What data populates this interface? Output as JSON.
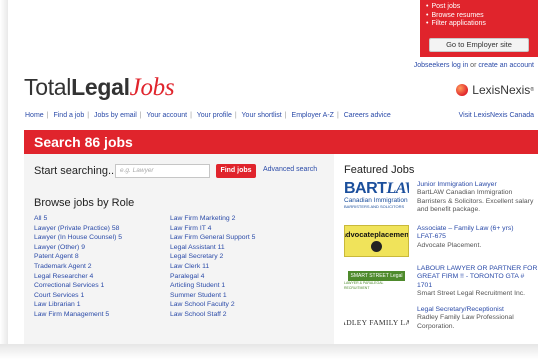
{
  "employer_box": {
    "items": [
      "Post jobs",
      "Browse resumes",
      "Filter applications"
    ],
    "button_label": "Go to Employer site"
  },
  "account_links": {
    "login": "Jobseekers log in",
    "or": "or",
    "create": "create an account"
  },
  "logo": {
    "part1": "Total",
    "part2": "Legal",
    "part3": "Jobs"
  },
  "partner_logo": {
    "label": "LexisNexis",
    "mark": "®"
  },
  "nav": {
    "items": [
      "Home",
      "Find a job",
      "Jobs by email",
      "Your account",
      "Your profile",
      "Your shortlist",
      "Employer A-Z",
      "Careers advice"
    ],
    "visit_link": "Visit LexisNexis Canada"
  },
  "search_banner": {
    "title": "Search 86 jobs"
  },
  "search": {
    "heading": "Start searching...",
    "placeholder": "e.g. Lawyer",
    "find_button": "Find jobs",
    "advanced_link": "Advanced search"
  },
  "browse": {
    "heading": "Browse jobs by Role",
    "col1": [
      {
        "label": "All",
        "count": "5"
      },
      {
        "label": "Lawyer (Private Practice)",
        "count": "58"
      },
      {
        "label": "Lawyer (In House Counsel)",
        "count": "5"
      },
      {
        "label": "Lawyer (Other)",
        "count": "9"
      },
      {
        "label": "Patent Agent",
        "count": "8"
      },
      {
        "label": "Trademark Agent",
        "count": "2"
      },
      {
        "label": "Legal Researcher",
        "count": "4"
      },
      {
        "label": "Correctional Services",
        "count": "1"
      },
      {
        "label": "Court Services",
        "count": "1"
      },
      {
        "label": "Law Librarian",
        "count": "1"
      },
      {
        "label": "Law Firm Management",
        "count": "5"
      }
    ],
    "col2": [
      {
        "label": "Law Firm Marketing",
        "count": "2"
      },
      {
        "label": "Law Firm IT",
        "count": "4"
      },
      {
        "label": "Law Firm General Support",
        "count": "5"
      },
      {
        "label": "Legal Assistant",
        "count": "11"
      },
      {
        "label": "Legal Secretary",
        "count": "2"
      },
      {
        "label": "Law Clerk",
        "count": "11"
      },
      {
        "label": "Paralegal",
        "count": "4"
      },
      {
        "label": "Articling Student",
        "count": "1"
      },
      {
        "label": "Summer Student",
        "count": "1"
      },
      {
        "label": "Law School Faculty",
        "count": "2"
      },
      {
        "label": "Law School Staff",
        "count": "2"
      }
    ]
  },
  "featured": {
    "heading": "Featured Jobs",
    "jobs": [
      {
        "title": "Junior Immigration Lawyer",
        "desc": "BartLAW Canadian Immigration Barristers & Solicitors. Excellent salary and benefit package.",
        "logo": {
          "line1": "BART",
          "line1b": "LAW",
          "line2": "Canadian Immigration",
          "line3": "BARRISTERS AND SOLICITORS"
        }
      },
      {
        "title": "Associate – Family Law (6+ yrs)",
        "title2": "LFAT-675",
        "desc": "Advocate Placement.",
        "logo": {
          "line1": "advocateplacement",
          "line2": "LAW"
        }
      },
      {
        "title": "LABOUR LAWYER OR PARTNER FOR GREAT FIRM !! - TORONTO GTA # 1701",
        "desc": "Smart Street Legal Recruitment Inc.",
        "logo": {
          "line1": "SMART STREET Legal",
          "line2": "LAWYER & PARALEGAL RECRUITMENT"
        }
      },
      {
        "title": "Legal Secretary/Receptionist",
        "desc": "Radley Family Law Professional Corporation.",
        "logo": {
          "line1": "RADLEY FAMILY LAW"
        }
      }
    ]
  },
  "colors": {
    "brand_red": "#e0242c",
    "link_blue": "#2a4aa8"
  }
}
